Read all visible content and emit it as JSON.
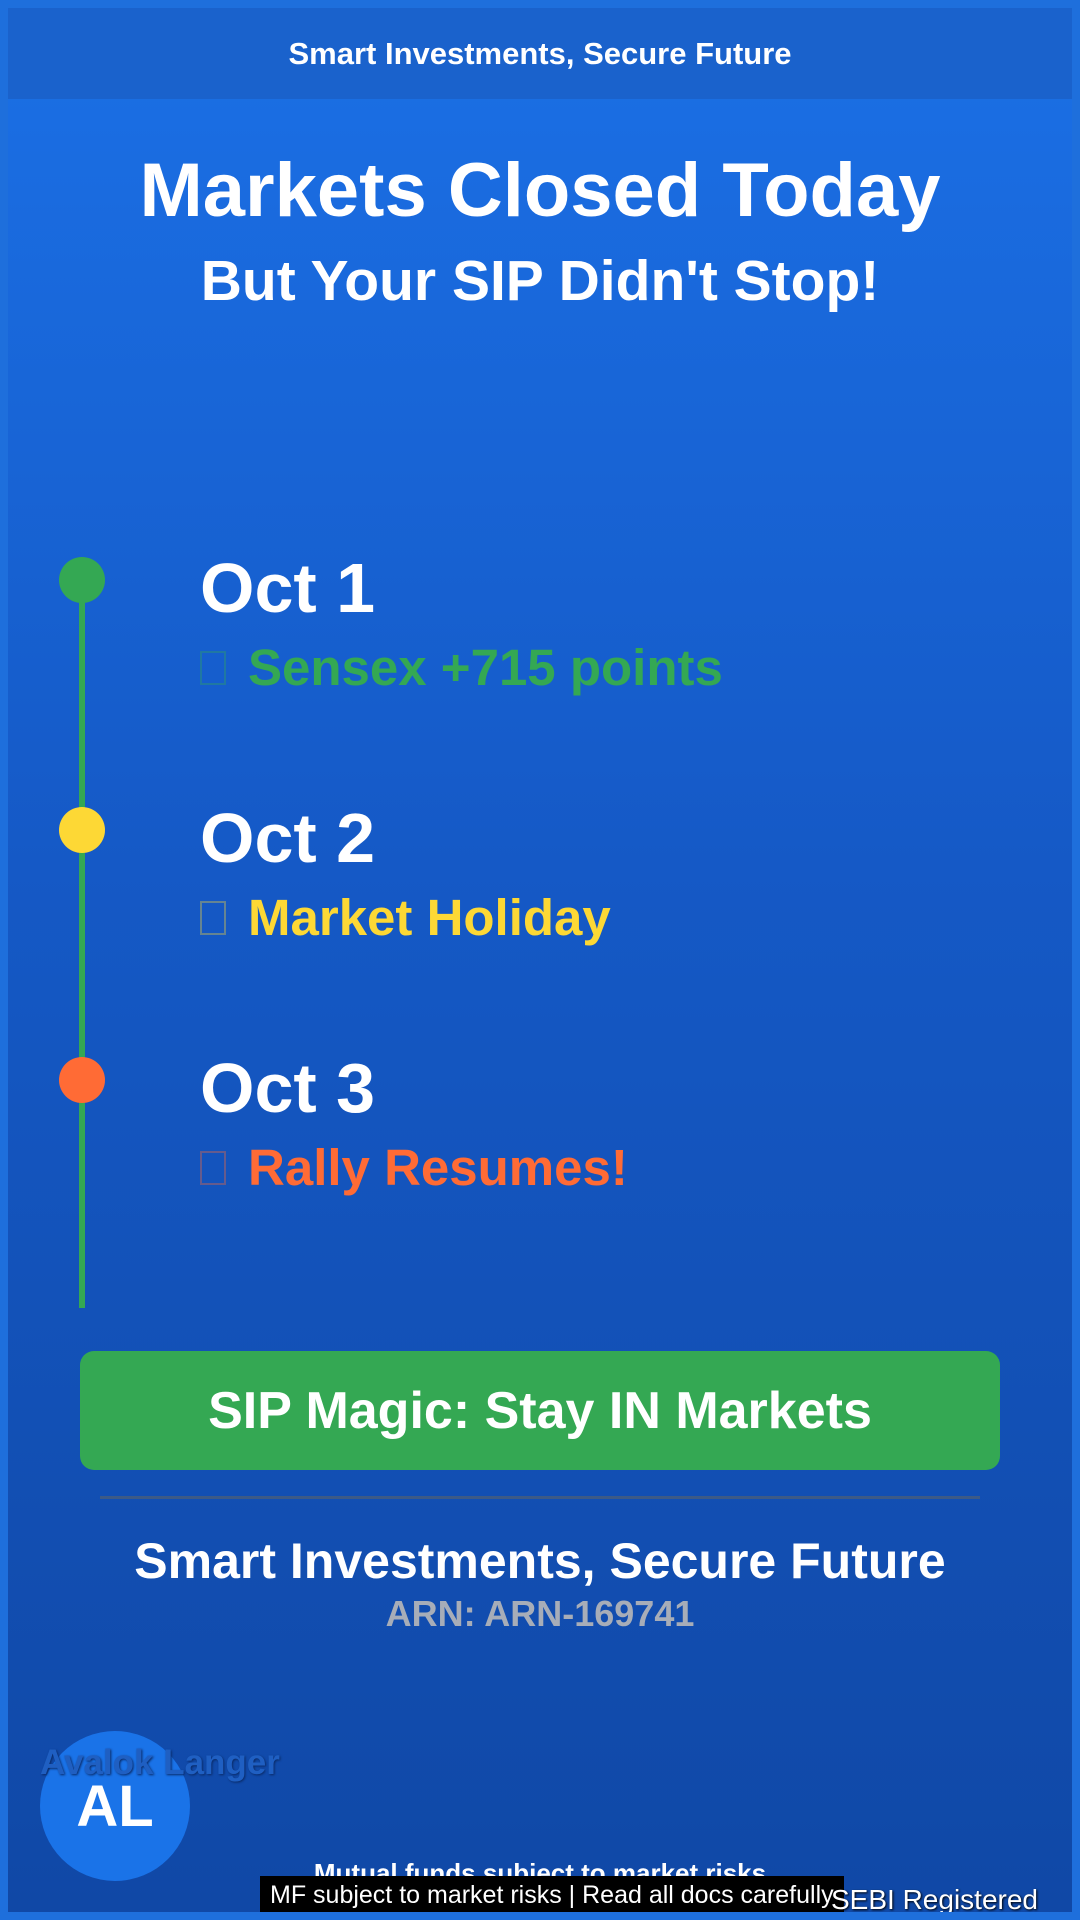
{
  "header": {
    "banner": "Smart Investments, Secure Future"
  },
  "hero": {
    "title": "Markets Closed Today",
    "subtitle": "But Your SIP Didn't Stop!"
  },
  "timeline": {
    "line_color": "#34a853",
    "items": [
      {
        "date": "Oct 1",
        "event": "Sensex +715 points",
        "color": "#34a853"
      },
      {
        "date": "Oct 2",
        "event": "Market Holiday",
        "color": "#fdd835"
      },
      {
        "date": "Oct 3",
        "event": "Rally Resumes!",
        "color": "#ff6b35"
      }
    ]
  },
  "cta": {
    "label": "SIP Magic: Stay IN Markets",
    "color": "#34a853"
  },
  "footer": {
    "tagline": "Smart Investments, Secure Future",
    "arn": "ARN: ARN-169741",
    "advisor_name": "Avalok Langer",
    "avatar_initials": "AL",
    "disclaimer": "Mutual funds subject to market risks",
    "risk_notice": "MF subject to market risks | Read all docs carefully",
    "sebi": "SEBI Registered"
  }
}
